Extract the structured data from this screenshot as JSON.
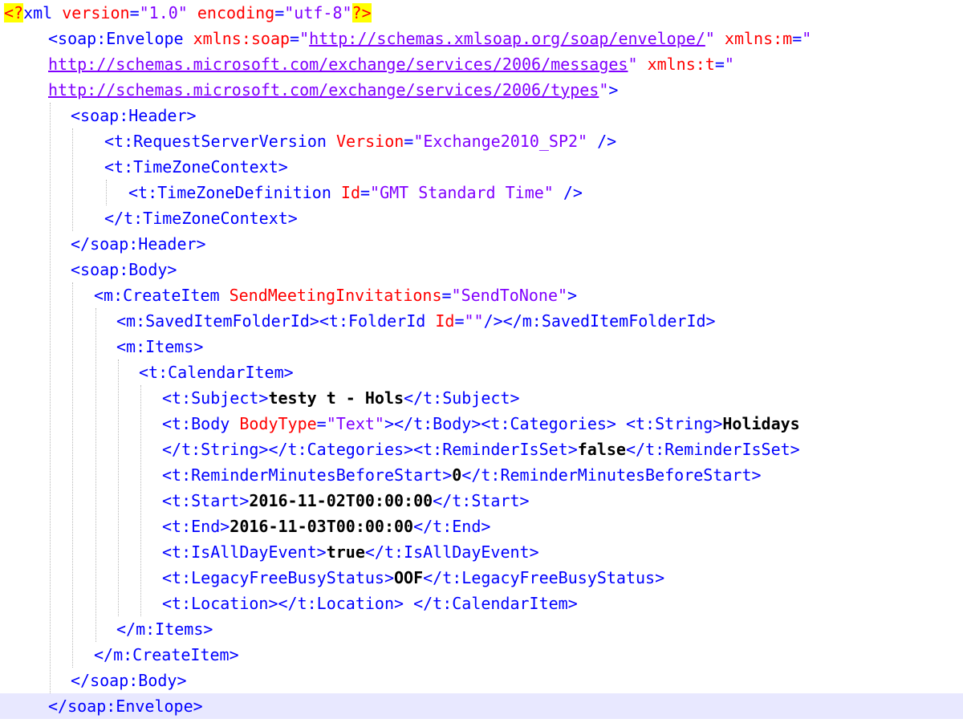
{
  "editor": {
    "current_line_index": 27,
    "colors": {
      "tag": "#0000ff",
      "attribute": "#ff0000",
      "value": "#8000ff",
      "text": "#000000",
      "pi_highlight": "#ffff00",
      "current_line": "#e8e8ff"
    },
    "lines": [
      [
        {
          "k": "pi",
          "t": "<?"
        },
        {
          "k": "tag",
          "t": "xml "
        },
        {
          "k": "attr",
          "t": "version"
        },
        {
          "k": "tag",
          "t": "="
        },
        {
          "k": "val",
          "t": "\"1.0\""
        },
        {
          "k": "tag",
          "t": " "
        },
        {
          "k": "attr",
          "t": "encoding"
        },
        {
          "k": "tag",
          "t": "="
        },
        {
          "k": "val",
          "t": "\"utf-8\""
        },
        {
          "k": "pi",
          "t": "?>"
        }
      ],
      [
        {
          "k": "tag",
          "t": "<soap:Envelope "
        },
        {
          "k": "attr",
          "t": "xmlns:soap"
        },
        {
          "k": "tag",
          "t": "="
        },
        {
          "k": "val",
          "t": "\""
        },
        {
          "k": "url",
          "t": "http://schemas.xmlsoap.org/soap/envelope/"
        },
        {
          "k": "val",
          "t": "\""
        },
        {
          "k": "tag",
          "t": " "
        },
        {
          "k": "attr",
          "t": "xmlns:m"
        },
        {
          "k": "tag",
          "t": "="
        },
        {
          "k": "val",
          "t": "\""
        }
      ],
      [
        {
          "k": "url",
          "t": "http://schemas.microsoft.com/exchange/services/2006/messages"
        },
        {
          "k": "val",
          "t": "\""
        },
        {
          "k": "tag",
          "t": " "
        },
        {
          "k": "attr",
          "t": "xmlns:t"
        },
        {
          "k": "tag",
          "t": "="
        },
        {
          "k": "val",
          "t": "\""
        }
      ],
      [
        {
          "k": "url",
          "t": "http://schemas.microsoft.com/exchange/services/2006/types"
        },
        {
          "k": "val",
          "t": "\""
        },
        {
          "k": "tag",
          "t": ">"
        }
      ],
      [
        {
          "k": "tag",
          "t": "<soap:Header>"
        }
      ],
      [
        {
          "k": "tag",
          "t": "<t:RequestServerVersion "
        },
        {
          "k": "attr",
          "t": "Version"
        },
        {
          "k": "tag",
          "t": "="
        },
        {
          "k": "val",
          "t": "\"Exchange2010_SP2\""
        },
        {
          "k": "tag",
          "t": " />"
        }
      ],
      [
        {
          "k": "tag",
          "t": "<t:TimeZoneContext>"
        }
      ],
      [
        {
          "k": "tag",
          "t": "<t:TimeZoneDefinition "
        },
        {
          "k": "attr",
          "t": "Id"
        },
        {
          "k": "tag",
          "t": "="
        },
        {
          "k": "val",
          "t": "\"GMT Standard Time\""
        },
        {
          "k": "tag",
          "t": " />"
        }
      ],
      [
        {
          "k": "tag",
          "t": "</t:TimeZoneContext>"
        }
      ],
      [
        {
          "k": "tag",
          "t": "</soap:Header>"
        }
      ],
      [
        {
          "k": "tag",
          "t": "<soap:Body>"
        }
      ],
      [
        {
          "k": "tag",
          "t": "<m:CreateItem "
        },
        {
          "k": "attr",
          "t": "SendMeetingInvitations"
        },
        {
          "k": "tag",
          "t": "="
        },
        {
          "k": "val",
          "t": "\"SendToNone\""
        },
        {
          "k": "tag",
          "t": ">"
        }
      ],
      [
        {
          "k": "tag",
          "t": "<m:SavedItemFolderId><t:FolderId "
        },
        {
          "k": "attr",
          "t": "Id"
        },
        {
          "k": "tag",
          "t": "="
        },
        {
          "k": "val",
          "t": "\"\""
        },
        {
          "k": "tag",
          "t": "/></m:SavedItemFolderId>"
        }
      ],
      [
        {
          "k": "tag",
          "t": "<m:Items>"
        }
      ],
      [
        {
          "k": "tag",
          "t": "<t:CalendarItem>"
        }
      ],
      [
        {
          "k": "tag",
          "t": "<t:Subject>"
        },
        {
          "k": "text",
          "t": "testy t - Hols"
        },
        {
          "k": "tag",
          "t": "</t:Subject>"
        }
      ],
      [
        {
          "k": "tag",
          "t": "<t:Body "
        },
        {
          "k": "attr",
          "t": "BodyType"
        },
        {
          "k": "tag",
          "t": "="
        },
        {
          "k": "val",
          "t": "\"Text\""
        },
        {
          "k": "tag",
          "t": "></t:Body><t:Categories> <t:String>"
        },
        {
          "k": "text",
          "t": "Holidays"
        }
      ],
      [
        {
          "k": "tag",
          "t": "</t:String></t:Categories><t:ReminderIsSet>"
        },
        {
          "k": "text",
          "t": "false"
        },
        {
          "k": "tag",
          "t": "</t:ReminderIsSet>"
        }
      ],
      [
        {
          "k": "tag",
          "t": "<t:ReminderMinutesBeforeStart>"
        },
        {
          "k": "text",
          "t": "0"
        },
        {
          "k": "tag",
          "t": "</t:ReminderMinutesBeforeStart>"
        }
      ],
      [
        {
          "k": "tag",
          "t": "<t:Start>"
        },
        {
          "k": "text",
          "t": "2016-11-02T00:00:00"
        },
        {
          "k": "tag",
          "t": "</t:Start>"
        }
      ],
      [
        {
          "k": "tag",
          "t": "<t:End>"
        },
        {
          "k": "text",
          "t": "2016-11-03T00:00:00"
        },
        {
          "k": "tag",
          "t": "</t:End>"
        }
      ],
      [
        {
          "k": "tag",
          "t": "<t:IsAllDayEvent>"
        },
        {
          "k": "text",
          "t": "true"
        },
        {
          "k": "tag",
          "t": "</t:IsAllDayEvent>"
        }
      ],
      [
        {
          "k": "tag",
          "t": "<t:LegacyFreeBusyStatus>"
        },
        {
          "k": "text",
          "t": "OOF"
        },
        {
          "k": "tag",
          "t": "</t:LegacyFreeBusyStatus>"
        }
      ],
      [
        {
          "k": "tag",
          "t": "<t:Location></t:Location> </t:CalendarItem>"
        }
      ],
      [
        {
          "k": "tag",
          "t": "</m:Items>"
        }
      ],
      [
        {
          "k": "tag",
          "t": "</m:CreateItem>"
        }
      ],
      [
        {
          "k": "tag",
          "t": "</soap:Body>"
        }
      ],
      [
        {
          "k": "tag",
          "t": "</soap:Envelope>"
        }
      ]
    ]
  }
}
